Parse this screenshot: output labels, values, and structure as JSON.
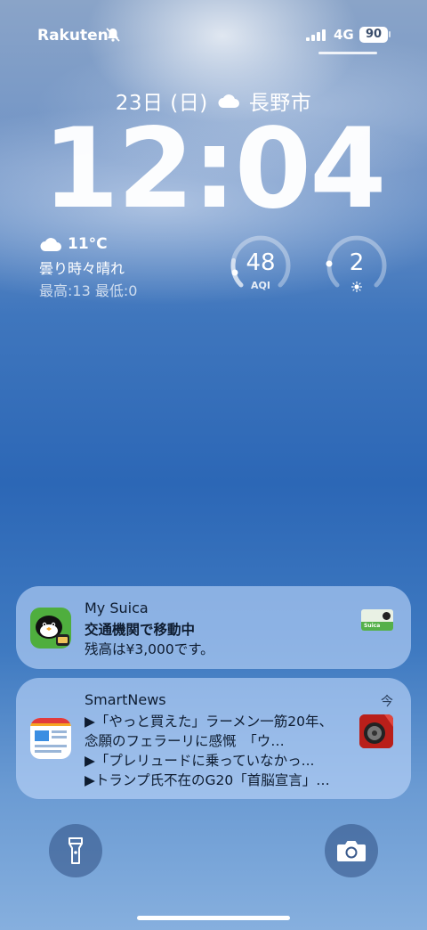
{
  "status": {
    "carrier": "Rakuten",
    "network": "4G",
    "battery": "90"
  },
  "lock": {
    "date": "23日 (日)",
    "location": "長野市",
    "time": "12:04"
  },
  "weather": {
    "temp": "11°C",
    "condition": "曇り時々晴れ",
    "range": "最高:13 最低:0",
    "icon": "cloud-icon"
  },
  "gauges": {
    "aqi": {
      "value": "48",
      "label": "AQI"
    },
    "uv": {
      "value": "2",
      "icon": "sun-icon"
    }
  },
  "notifications": [
    {
      "app": "My Suica",
      "title": "交通機関で移動中",
      "body": "残高は¥3,000です。",
      "thumb_label": "Suica"
    },
    {
      "app": "SmartNews",
      "time": "今",
      "lines": [
        "▶「やっと買えた」ラーメン一筋20年、",
        "念願のフェラーリに感慨　「ウ…",
        "▶「プレリュードに乗っていなかっ...",
        "▶トランプ氏不在のG20「首脳宣言」…"
      ]
    }
  ],
  "colors": {
    "notification_bg": "#bed7fa",
    "text_dark": "#0c1a2c"
  }
}
